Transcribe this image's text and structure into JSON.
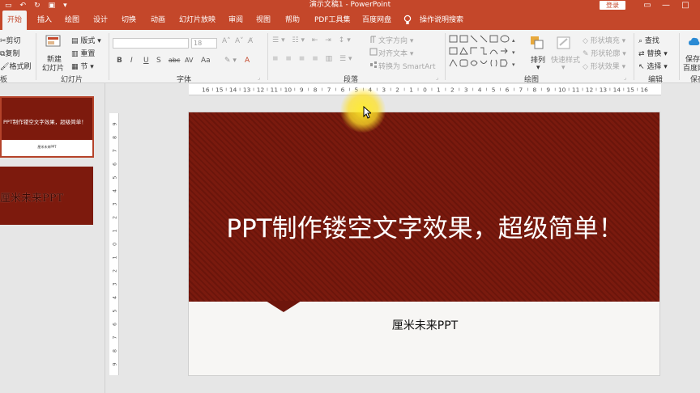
{
  "window": {
    "title": "演示文稿1  -  PowerPoint",
    "login_label": "登录",
    "controls": [
      "—",
      "□",
      "✕"
    ]
  },
  "tabs": [
    "开始",
    "插入",
    "绘图",
    "设计",
    "切换",
    "动画",
    "幻灯片放映",
    "审阅",
    "视图",
    "帮助",
    "PDF工具集",
    "百度网盘",
    "操作说明搜索"
  ],
  "ribbon": {
    "clipboard": {
      "cut": "剪切",
      "copy": "复制",
      "format_painter": "格式刷",
      "label": "板"
    },
    "slides": {
      "new_slide": "新建",
      "new_slide_2": "幻灯片",
      "layout": "版式",
      "reset": "重置",
      "section": "节",
      "label": "幻灯片"
    },
    "font": {
      "size": "18",
      "label": "字体",
      "buttons": [
        "B",
        "I",
        "U",
        "S",
        "abc",
        "AV",
        "Aa",
        "A"
      ]
    },
    "paragraph": {
      "text_direction": "文字方向",
      "align_text": "对齐文本",
      "smartart": "转换为 SmartArt",
      "label": "段落"
    },
    "drawing": {
      "arrange": "排列",
      "quick_styles": "快速样式",
      "shape_fill": "形状填充",
      "shape_outline": "形状轮廓",
      "shape_effects": "形状效果",
      "label": "绘图"
    },
    "editing": {
      "find": "查找",
      "replace": "替换",
      "select": "选择",
      "label": "编辑"
    },
    "save": {
      "line1": "保存",
      "line2": "百度网",
      "label": "保存"
    }
  },
  "thumbnails": [
    {
      "title": "PPT制作镂空文字效果，超级简单！",
      "subtitle": "厘米未来PPT"
    },
    {
      "title": "厘米未来PPT"
    }
  ],
  "ruler": {
    "labels": [
      "16",
      "15",
      "14",
      "13",
      "12",
      "11",
      "10",
      "9",
      "8",
      "7",
      "6",
      "5",
      "4",
      "3",
      "2",
      "1",
      "0",
      "1",
      "2",
      "3",
      "4",
      "5",
      "6",
      "7",
      "8",
      "9",
      "10",
      "11",
      "12",
      "13",
      "14",
      "15",
      "16"
    ]
  },
  "slide": {
    "title": "PPT制作镂空文字效果，超级简单！",
    "subtitle": "厘米未来PPT",
    "band_color": "#7a1a0e"
  },
  "colors": {
    "accent": "#c4472a",
    "ribbon_bg": "#f3f3f3"
  }
}
